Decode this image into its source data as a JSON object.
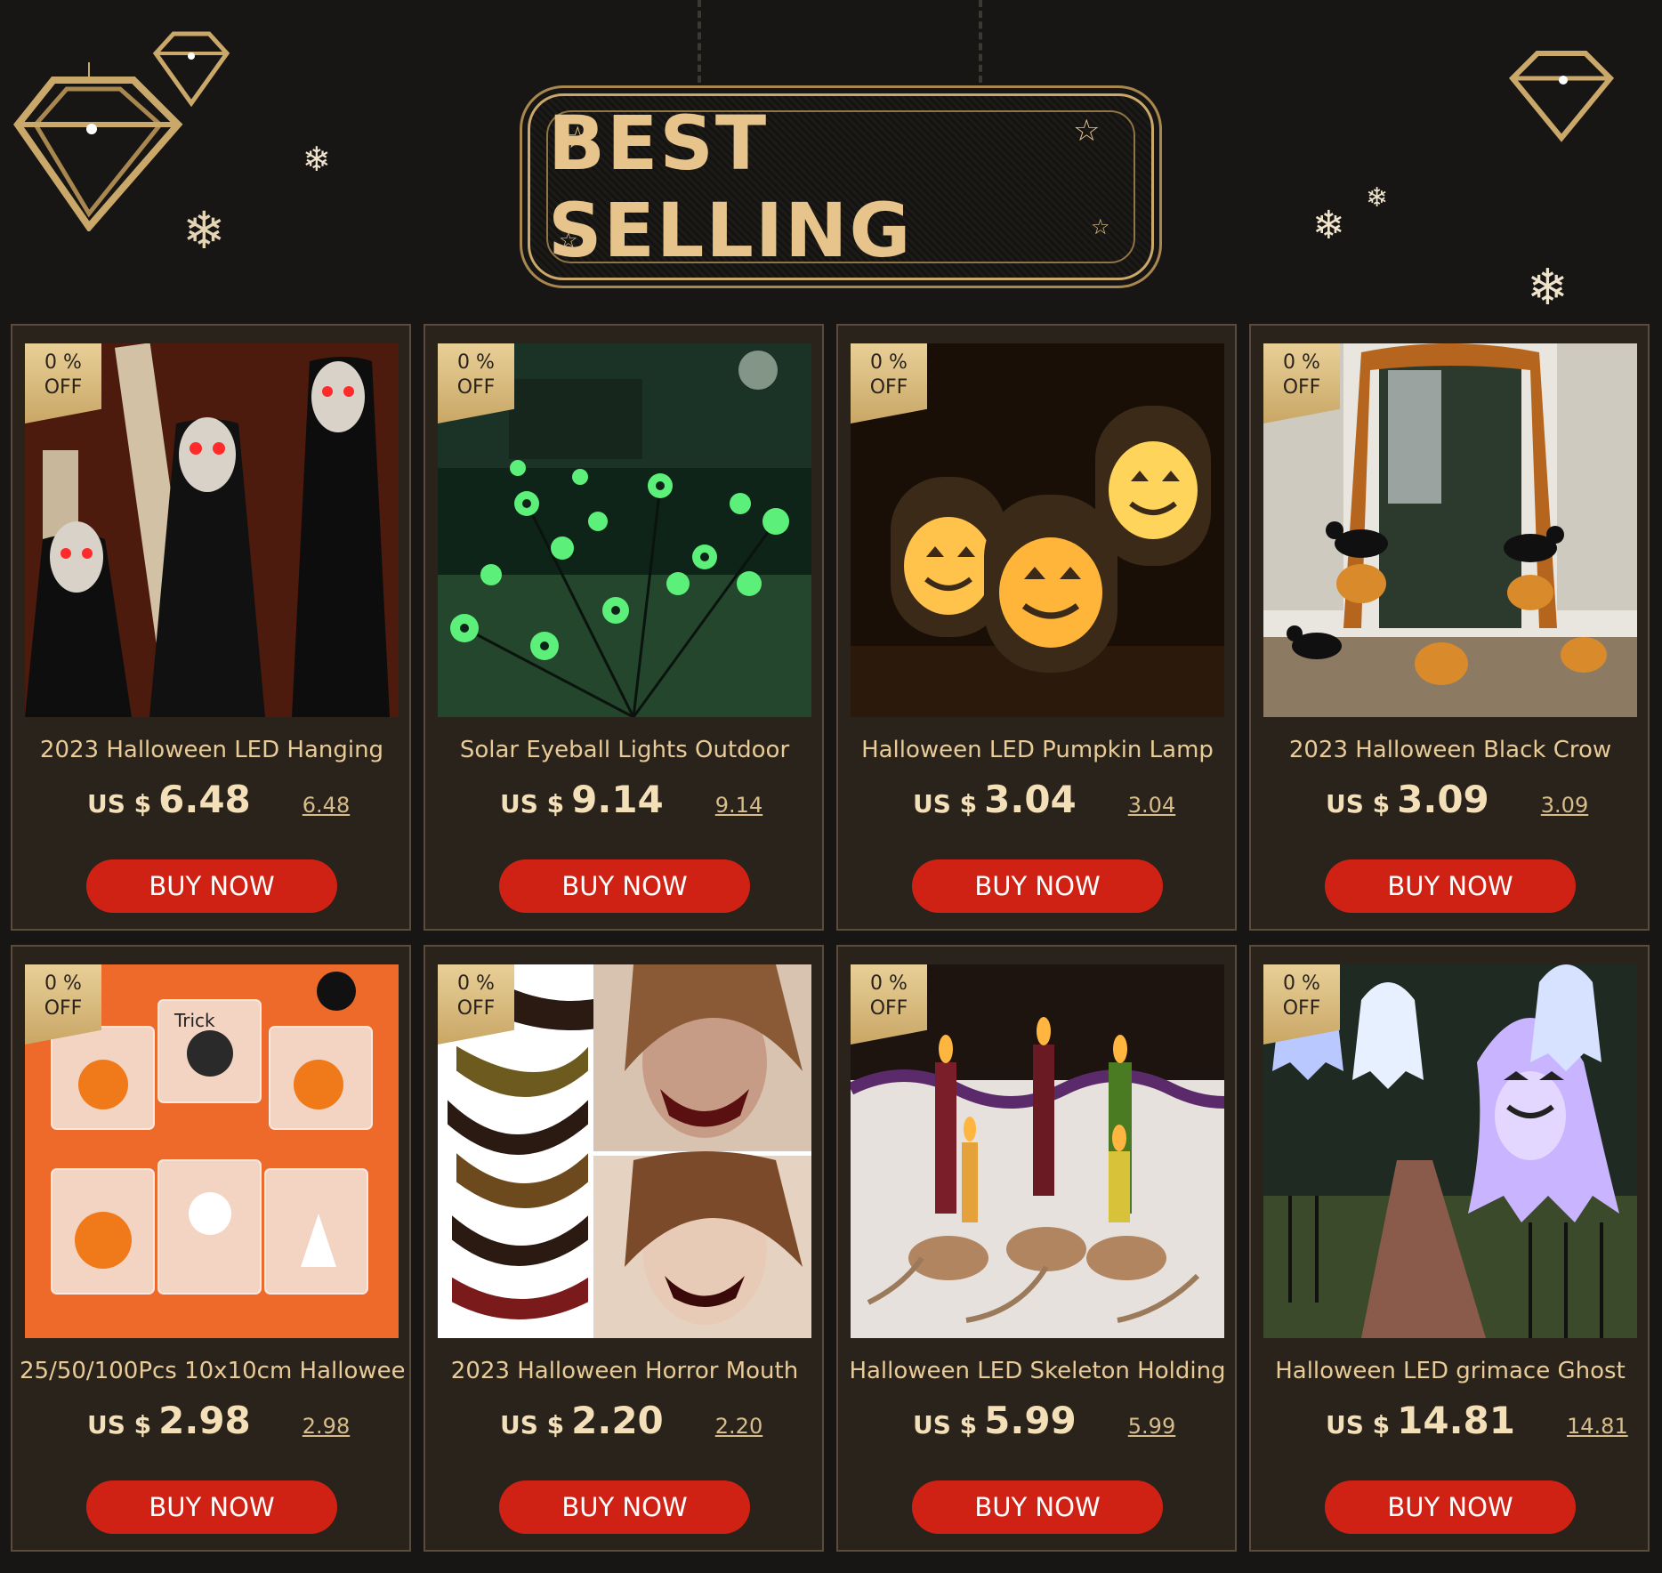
{
  "header": {
    "title": "BEST SELLING"
  },
  "products": [
    {
      "discount": "0 % OFF",
      "title": "2023 Halloween LED Hanging",
      "currency": "US $",
      "price": "6.48",
      "old_price": "6.48",
      "button": "BUY NOW",
      "image": "skull-ghosts"
    },
    {
      "discount": "0 % OFF",
      "title": "Solar Eyeball Lights Outdoor",
      "currency": "US $",
      "price": "9.14",
      "old_price": "9.14",
      "button": "BUY NOW",
      "image": "eyeball-lights"
    },
    {
      "discount": "0 % OFF",
      "title": "Halloween LED Pumpkin Lamp",
      "currency": "US $",
      "price": "3.04",
      "old_price": "3.04",
      "button": "BUY NOW",
      "image": "pumpkin-lanterns"
    },
    {
      "discount": "0 % OFF",
      "title": "2023 Halloween Black Crow",
      "currency": "US $",
      "price": "3.09",
      "old_price": "3.09",
      "button": "BUY NOW",
      "image": "porch-crows"
    },
    {
      "discount": "0 % OFF",
      "title": "25/50/100Pcs 10x10cm Halloween",
      "currency": "US $",
      "price": "2.98",
      "old_price": "2.98",
      "button": "BUY NOW",
      "image": "candy-bags"
    },
    {
      "discount": "0 % OFF",
      "title": "2023 Halloween Horror Mouth",
      "currency": "US $",
      "price": "2.20",
      "old_price": "2.20",
      "button": "BUY NOW",
      "image": "mouth-tattoos"
    },
    {
      "discount": "0 % OFF",
      "title": "Halloween LED Skeleton Holding",
      "currency": "US $",
      "price": "5.99",
      "old_price": "5.99",
      "button": "BUY NOW",
      "image": "skeleton-candles"
    },
    {
      "discount": "0 % OFF",
      "title": "Halloween LED grimace Ghost",
      "currency": "US $",
      "price": "14.81",
      "old_price": "14.81",
      "button": "BUY NOW",
      "image": "ghost-lights"
    }
  ],
  "colors": {
    "background": "#181614",
    "card": "#2a231c",
    "gold": "#e6c48b",
    "button": "#cf2214"
  }
}
